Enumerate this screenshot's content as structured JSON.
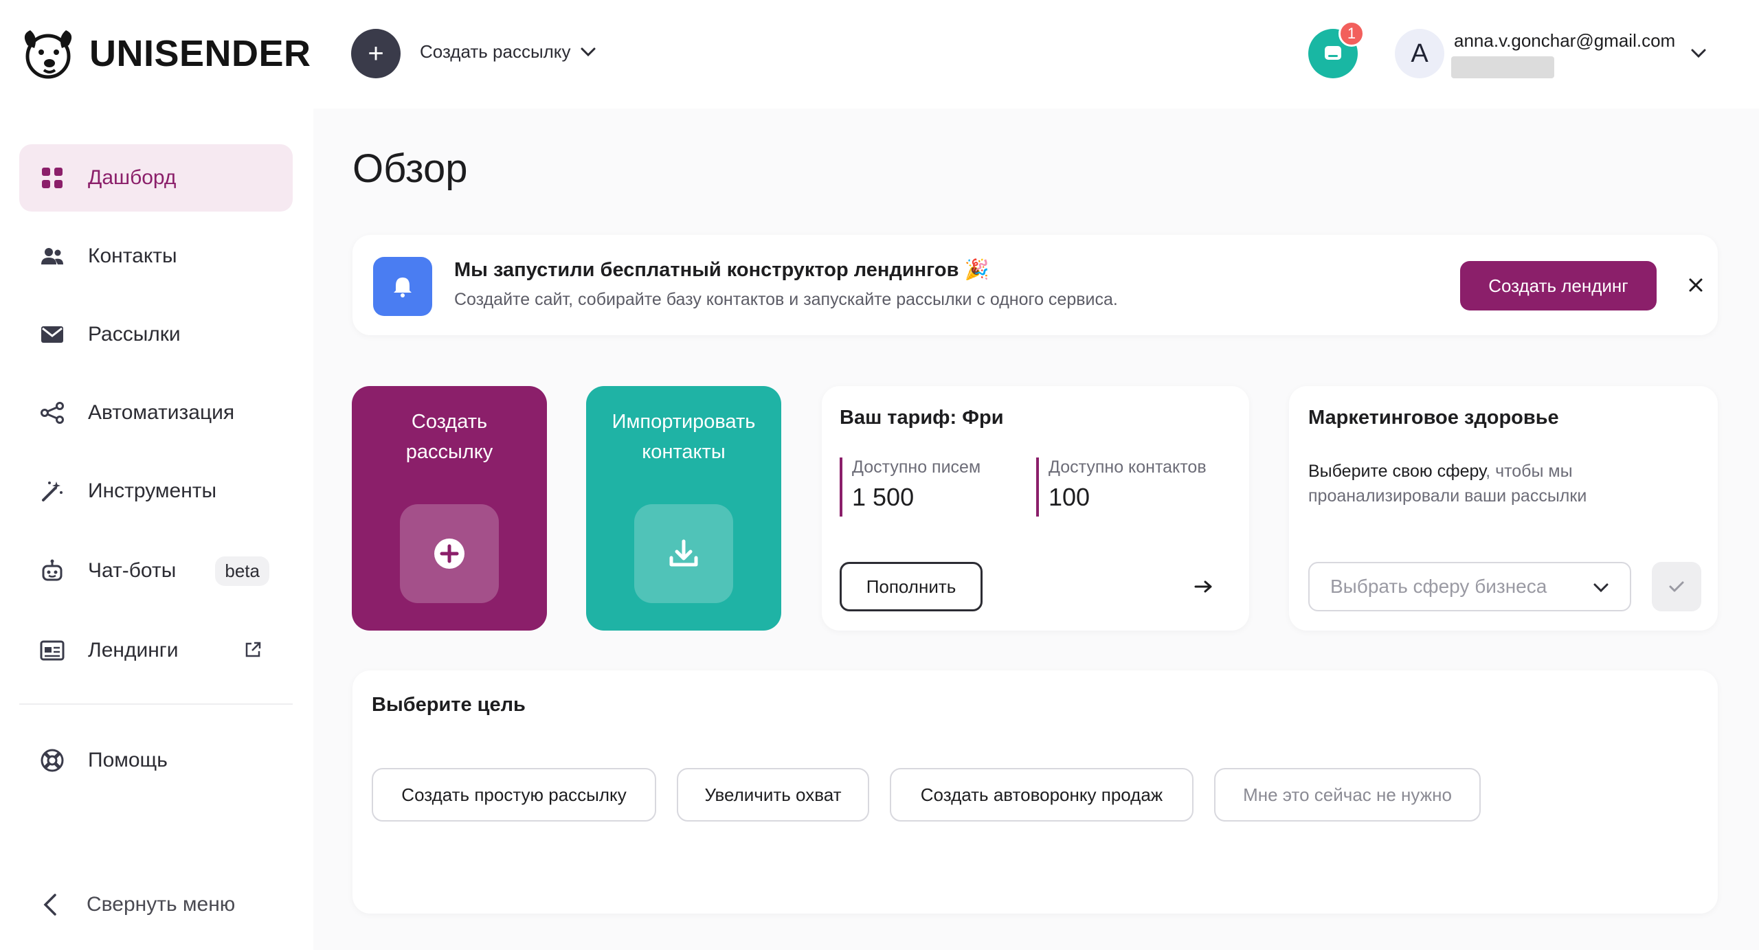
{
  "header": {
    "logo_text": "UNISENDER",
    "create_label": "Создать рассылку",
    "notifications_count": "1",
    "avatar_letter": "A",
    "user_email": "anna.v.gonchar@gmail.com"
  },
  "sidebar": {
    "items": [
      {
        "label": "Дашборд",
        "icon": "dashboard-icon",
        "active": true
      },
      {
        "label": "Контакты",
        "icon": "contacts-icon"
      },
      {
        "label": "Рассылки",
        "icon": "mail-icon"
      },
      {
        "label": "Автоматизация",
        "icon": "automation-icon"
      },
      {
        "label": "Инструменты",
        "icon": "tools-icon"
      },
      {
        "label": "Чат-боты",
        "icon": "chatbot-icon",
        "badge": "beta"
      },
      {
        "label": "Лендинги",
        "icon": "landing-icon",
        "external": true
      },
      {
        "label": "Помощь",
        "icon": "help-icon"
      }
    ],
    "collapse_label": "Свернуть меню"
  },
  "page": {
    "title": "Обзор"
  },
  "banner": {
    "title": "Мы запустили бесплатный конструктор лендингов 🎉",
    "text": "Создайте сайт, собирайте базу контактов и запускайте рассылки с одного сервиса.",
    "button_label": "Создать лендинг"
  },
  "cards": {
    "create": {
      "line1": "Создать",
      "line2": "рассылку"
    },
    "import": {
      "line1": "Импортировать",
      "line2": "контакты"
    }
  },
  "tariff": {
    "title": "Ваш тариф: Фри",
    "letters_label": "Доступно писем",
    "letters_value": "1 500",
    "contacts_label": "Доступно контактов",
    "contacts_value": "100",
    "topup_label": "Пополнить"
  },
  "health": {
    "title": "Маркетинговое здоровье",
    "desc_strong": "Выберите свою сферу",
    "desc_rest": ", чтобы мы проанализировали ваши рассылки",
    "select_placeholder": "Выбрать сферу бизнеса"
  },
  "goals": {
    "title": "Выберите цель",
    "options": [
      "Создать простую рассылку",
      "Увеличить охват",
      "Создать автоворонку продаж",
      "Мне это сейчас не нужно"
    ]
  },
  "colors": {
    "brand": "#8b1f6a",
    "teal": "#1fb3a5",
    "blue": "#4a7df2",
    "badge_red": "#f25f5c"
  }
}
